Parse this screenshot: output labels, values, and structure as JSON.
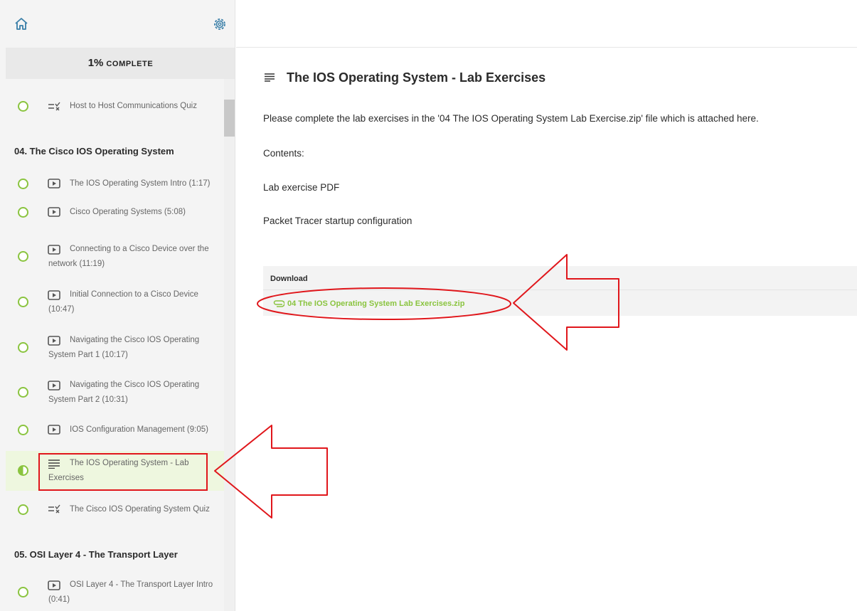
{
  "sidebar": {
    "progress_pct": "1%",
    "progress_label": "COMPLETE",
    "prev_lesson": "Host to Host Communications Quiz",
    "section_04": "04. The Cisco IOS Operating System",
    "lessons": [
      {
        "title": "The IOS Operating System Intro (1:17)"
      },
      {
        "title": "Cisco Operating Systems (5:08)"
      },
      {
        "title": "Connecting to a Cisco Device over the network (11:19)"
      },
      {
        "title": "Initial Connection to a Cisco Device (10:47)"
      },
      {
        "title": "Navigating the Cisco IOS Operating System Part 1 (10:17)"
      },
      {
        "title": "Navigating the Cisco IOS Operating System Part 2 (10:31)"
      },
      {
        "title": "IOS Configuration Management (9:05)"
      },
      {
        "title": "The IOS Operating System - Lab Exercises"
      },
      {
        "title": "The Cisco IOS Operating System Quiz"
      }
    ],
    "section_05": "05. OSI Layer 4 - The Transport Layer",
    "section_05_lesson": "OSI Layer 4 - The Transport Layer Intro (0:41)"
  },
  "main": {
    "title": "The IOS Operating System - Lab Exercises",
    "intro": "Please complete the lab exercises in the '04 The IOS Operating System Lab Exercise.zip' file which is attached here.",
    "contents_label": "Contents:",
    "items": [
      "Lab exercise PDF",
      "Packet Tracer startup configuration"
    ],
    "download_header": "Download",
    "download_file": "04 The IOS Operating System Lab Exercises.zip"
  },
  "colors": {
    "accent_green": "#8ac43f",
    "annotation_red": "#e0161b",
    "active_lesson_bg": "#eef7df"
  }
}
